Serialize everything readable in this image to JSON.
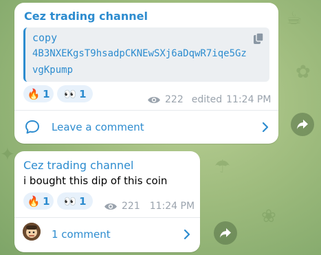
{
  "messages": [
    {
      "channel": "Cez trading channel",
      "code": {
        "language": "copy",
        "lines": [
          "4B3NXEKgsT9hsadpCKNEwSXj6aDqwR7iqe5Gz",
          "vgKpump"
        ],
        "copy_icon": "copy-icon"
      },
      "reactions": [
        {
          "emoji": "🔥",
          "count": "1"
        },
        {
          "emoji": "👀",
          "count": "1"
        }
      ],
      "views": "222",
      "edited_label": "edited",
      "time": "11:24 PM",
      "comment_label": "Leave a comment"
    },
    {
      "channel": "Cez trading channel",
      "text": "i bought this dip of this coin",
      "reactions": [
        {
          "emoji": "🔥",
          "count": "1"
        },
        {
          "emoji": "👀",
          "count": "1"
        }
      ],
      "views": "221",
      "time": "11:24 PM",
      "comment_label": "1 comment"
    }
  ],
  "colors": {
    "accent": "#2d8ccf",
    "meta": "#9aa3ad",
    "reaction_bg": "#e7f1fb",
    "code_bg": "#eceff2"
  }
}
